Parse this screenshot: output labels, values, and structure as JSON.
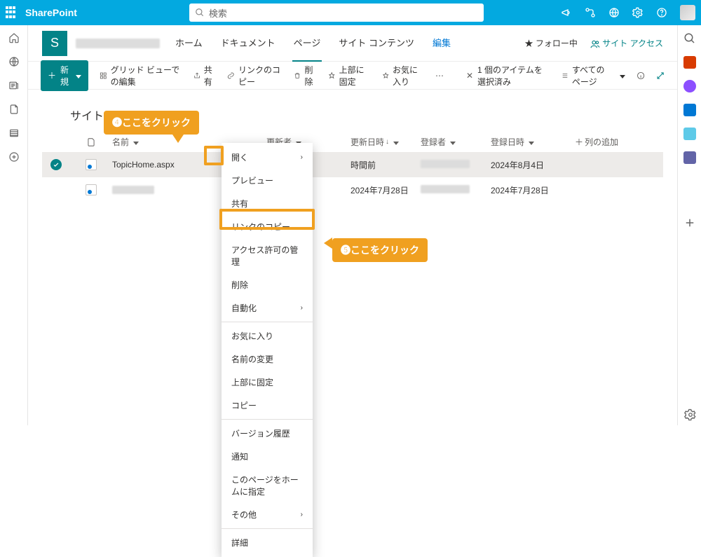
{
  "suite": {
    "brand": "SharePoint",
    "search_placeholder": "検索"
  },
  "site": {
    "logo_letter": "S",
    "nav": {
      "home": "ホーム",
      "documents": "ドキュメント",
      "pages": "ページ",
      "contents": "サイト コンテンツ",
      "edit": "編集"
    },
    "follow": "フォロー中",
    "site_access": "サイト アクセス"
  },
  "cmd": {
    "new": "新規",
    "grid": "グリッド ビューでの編集",
    "share": "共有",
    "copylink": "リンクのコピー",
    "delete": "削除",
    "pin": "上部に固定",
    "fav": "お気に入り",
    "selected": "1 個のアイテムを選択済み",
    "allpages": "すべてのページ"
  },
  "page_title": "サイトのページ",
  "callouts": {
    "c4": "❹ここをクリック",
    "c5": "❺ここをクリック"
  },
  "columns": {
    "name": "名前",
    "modifiedby": "更新者",
    "modified": "更新日時",
    "createdby": "登録者",
    "created": "登録日時",
    "add": "列の追加"
  },
  "rows": [
    {
      "name": "TopicHome.aspx",
      "modified": "時間前",
      "created": "2024年8月4日",
      "selected": true
    },
    {
      "name": "",
      "modified": "2024年7月28日",
      "created": "2024年7月28日",
      "selected": false
    }
  ],
  "ctx": {
    "open": "開く",
    "preview": "プレビュー",
    "share": "共有",
    "copylink": "リンクのコピー",
    "manageaccess": "アクセス許可の管理",
    "delete": "削除",
    "automate": "自動化",
    "favorite": "お気に入り",
    "rename": "名前の変更",
    "pin": "上部に固定",
    "copy": "コピー",
    "versions": "バージョン履歴",
    "notify": "通知",
    "sethome": "このページをホームに指定",
    "more": "その他",
    "details": "詳細"
  }
}
